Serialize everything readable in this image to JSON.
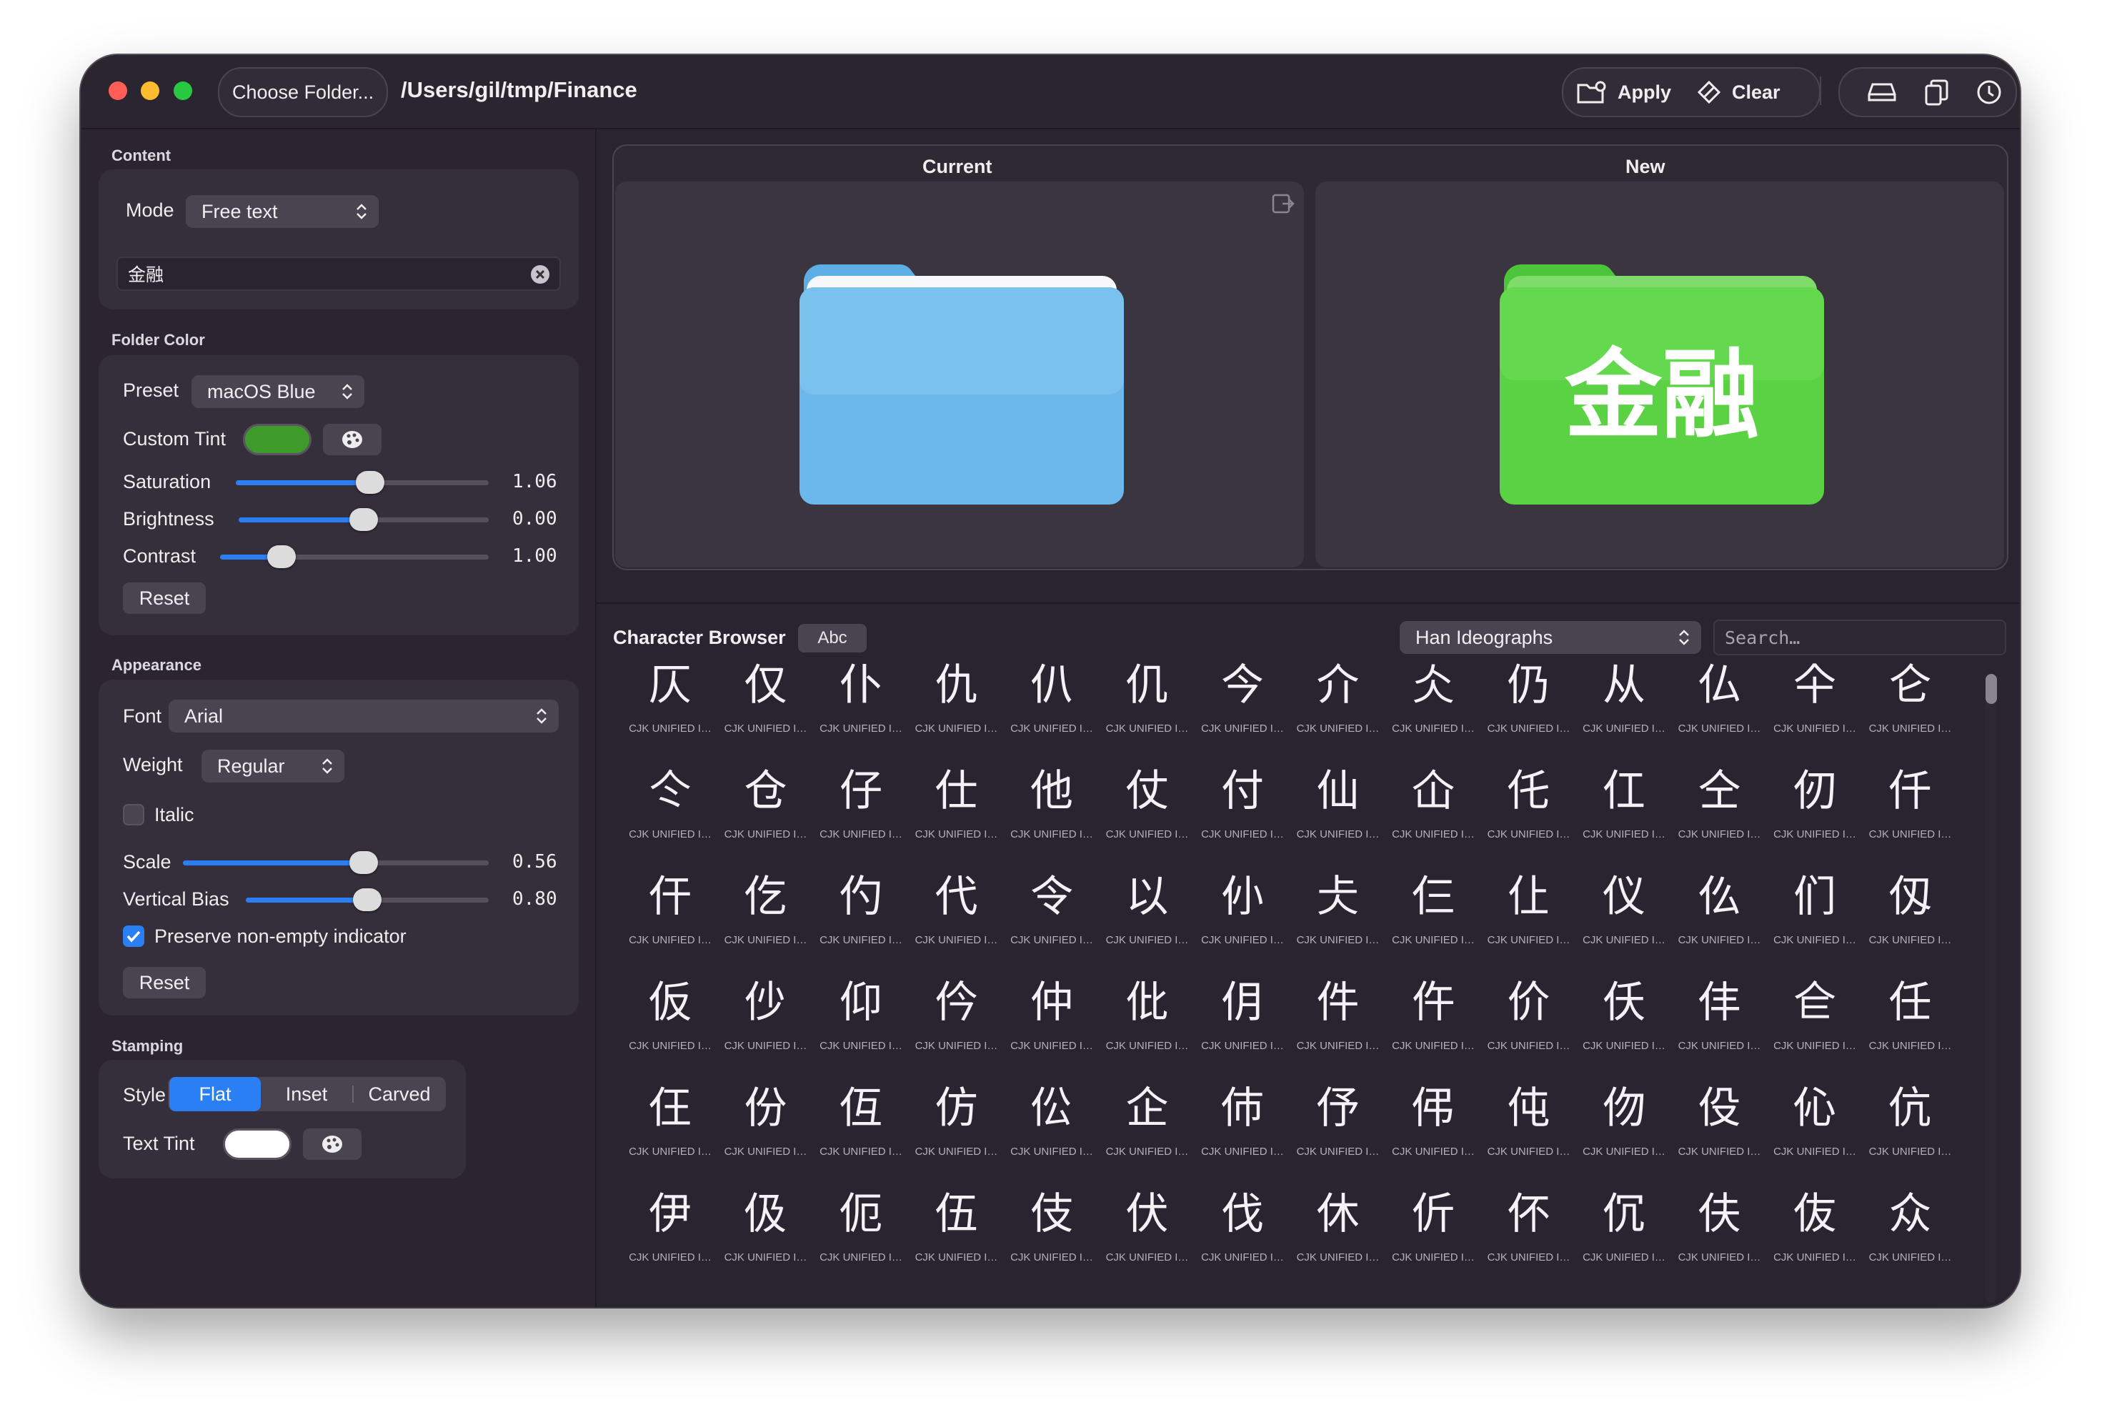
{
  "toolbar": {
    "choose_folder": "Choose Folder...",
    "path": "/Users/gil/tmp/Finance",
    "apply": "Apply",
    "clear": "Clear"
  },
  "content": {
    "section": "Content",
    "mode_label": "Mode",
    "mode_value": "Free text",
    "text_value": "金融"
  },
  "folder_color": {
    "section": "Folder Color",
    "preset_label": "Preset",
    "preset_value": "macOS Blue",
    "custom_tint_label": "Custom Tint",
    "tint_color": "#3f9a2c",
    "saturation_label": "Saturation",
    "saturation_value": "1.06",
    "saturation_fill": 0.53,
    "brightness_label": "Brightness",
    "brightness_value": "0.00",
    "brightness_fill": 0.5,
    "contrast_label": "Contrast",
    "contrast_value": "1.00",
    "contrast_fill": 0.23,
    "reset": "Reset"
  },
  "appearance": {
    "section": "Appearance",
    "font_label": "Font",
    "font_value": "Arial",
    "weight_label": "Weight",
    "weight_value": "Regular",
    "italic_label": "Italic",
    "italic_checked": false,
    "scale_label": "Scale",
    "scale_value": "0.56",
    "scale_fill": 0.59,
    "vbias_label": "Vertical Bias",
    "vbias_value": "0.80",
    "vbias_fill": 0.5,
    "preserve_label": "Preserve non-empty indicator",
    "preserve_checked": true,
    "reset": "Reset"
  },
  "stamping": {
    "section": "Stamping",
    "style_label": "Style",
    "styles": [
      "Flat",
      "Inset",
      "Carved"
    ],
    "active_style": "Flat",
    "text_tint_label": "Text Tint",
    "text_tint_color": "#ffffff"
  },
  "preview": {
    "current_label": "Current",
    "new_label": "New",
    "current_color": "#5eaee6",
    "new_color": "#4cc53a",
    "new_text": "金融"
  },
  "browser": {
    "title": "Character Browser",
    "abc": "Abc",
    "category": "Han Ideographs",
    "search_placeholder": "Search…",
    "cell_name": "CJK UNIFIED I…",
    "chars": [
      [
        "仄",
        "仅",
        "仆",
        "仇",
        "仈",
        "仉",
        "今",
        "介",
        "仌",
        "仍",
        "从",
        "仏",
        "仐",
        "仑"
      ],
      [
        "仒",
        "仓",
        "仔",
        "仕",
        "他",
        "仗",
        "付",
        "仙",
        "仚",
        "仛",
        "仜",
        "仝",
        "仞",
        "仟"
      ],
      [
        "仠",
        "仡",
        "仢",
        "代",
        "令",
        "以",
        "仦",
        "仧",
        "仨",
        "仩",
        "仪",
        "仫",
        "们",
        "仭"
      ],
      [
        "仮",
        "仯",
        "仰",
        "仱",
        "仲",
        "仳",
        "仴",
        "件",
        "仵",
        "价",
        "仸",
        "仹",
        "仺",
        "任"
      ],
      [
        "仼",
        "份",
        "仾",
        "仿",
        "伀",
        "企",
        "伂",
        "伃",
        "伄",
        "伅",
        "伆",
        "伇",
        "伈",
        "伉"
      ],
      [
        "伊",
        "伋",
        "伌",
        "伍",
        "伎",
        "伏",
        "伐",
        "休",
        "伒",
        "伓",
        "伔",
        "伕",
        "伖",
        "众"
      ]
    ]
  }
}
